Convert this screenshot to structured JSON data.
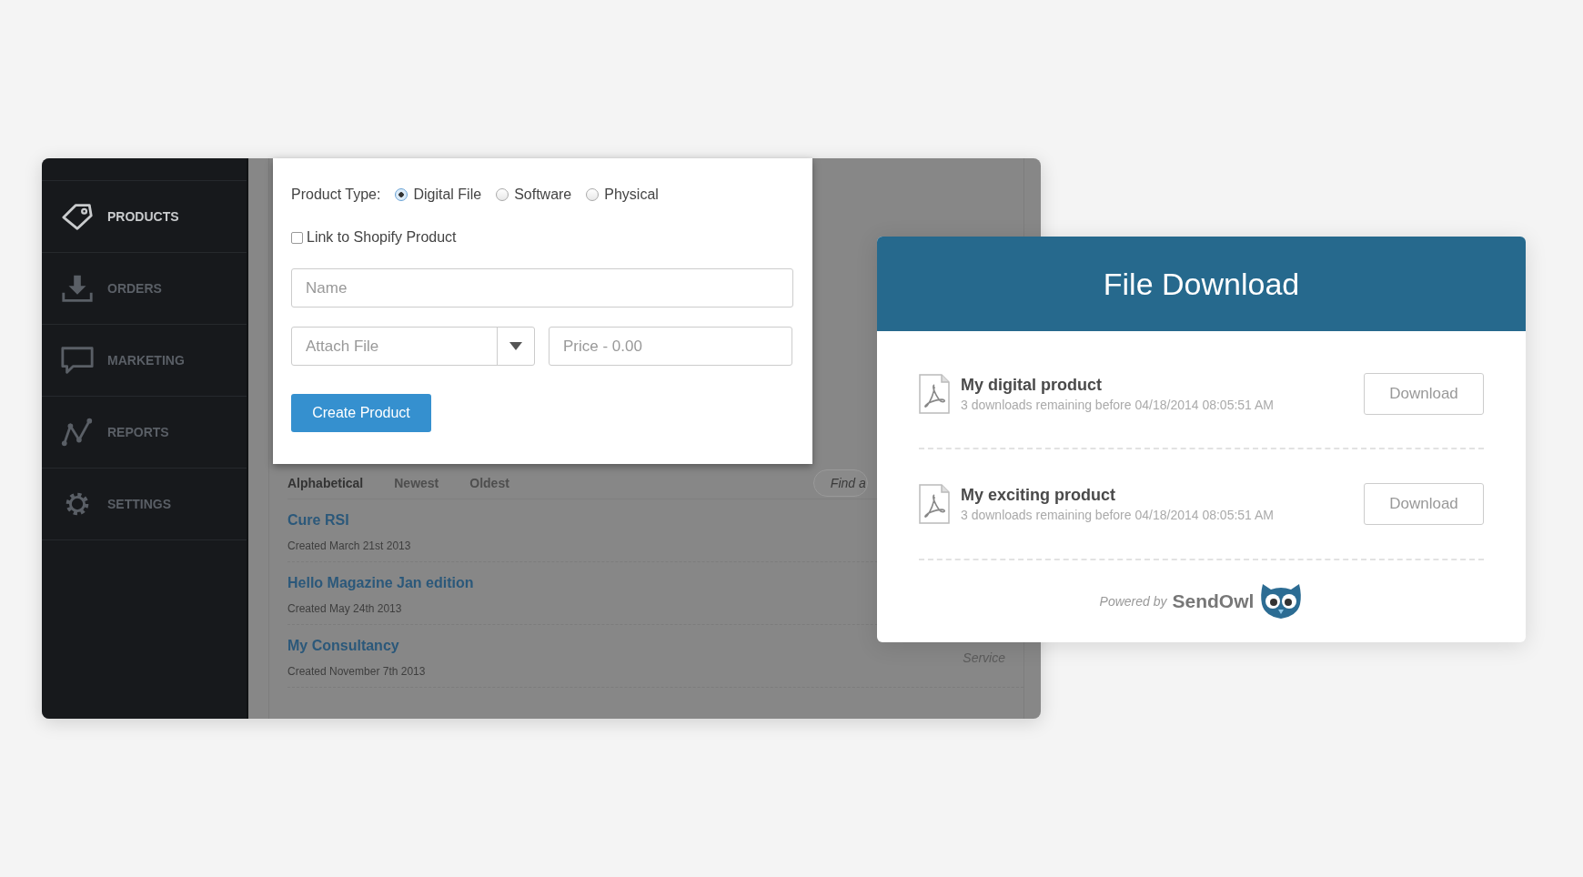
{
  "sidebar": {
    "items": [
      {
        "label": "PRODUCTS",
        "selected": true
      },
      {
        "label": "ORDERS",
        "selected": false
      },
      {
        "label": "MARKETING",
        "selected": false
      },
      {
        "label": "REPORTS",
        "selected": false
      },
      {
        "label": "SETTINGS",
        "selected": false
      }
    ]
  },
  "product_list": {
    "sort_tabs": [
      {
        "label": "Alphabetical",
        "selected": true
      },
      {
        "label": "Newest",
        "selected": false
      },
      {
        "label": "Oldest",
        "selected": false
      }
    ],
    "search": {
      "placeholder": "Find a"
    },
    "products": [
      {
        "name": "Cure RSI",
        "created": "Created March 21st 2013"
      },
      {
        "name": "Hello Magazine Jan edition",
        "created": "Created May 24th 2013"
      },
      {
        "name": "My Consultancy",
        "created": "Created November 7th 2013",
        "type": "Service"
      }
    ]
  },
  "new_product_form": {
    "product_type_label": "Product Type:",
    "product_types": [
      {
        "label": "Digital File",
        "selected": true
      },
      {
        "label": "Software",
        "selected": false
      },
      {
        "label": "Physical",
        "selected": false
      }
    ],
    "shopify_link": {
      "label": "Link to Shopify Product",
      "checked": false
    },
    "name": {
      "placeholder": "Name"
    },
    "attach_file": {
      "placeholder": "Attach File"
    },
    "price": {
      "placeholder": "Price - 0.00"
    },
    "submit": "Create Product"
  },
  "file_download": {
    "title": "File Download",
    "items": [
      {
        "name": "My digital product",
        "note": "3 downloads remaining before 04/18/2014 08:05:51 AM",
        "button": "Download"
      },
      {
        "name": "My exciting product",
        "note": "3 downloads remaining before 04/18/2014 08:05:51 AM",
        "button": "Download"
      }
    ],
    "powered_by": "Powered by",
    "brand": "SendOwl"
  }
}
